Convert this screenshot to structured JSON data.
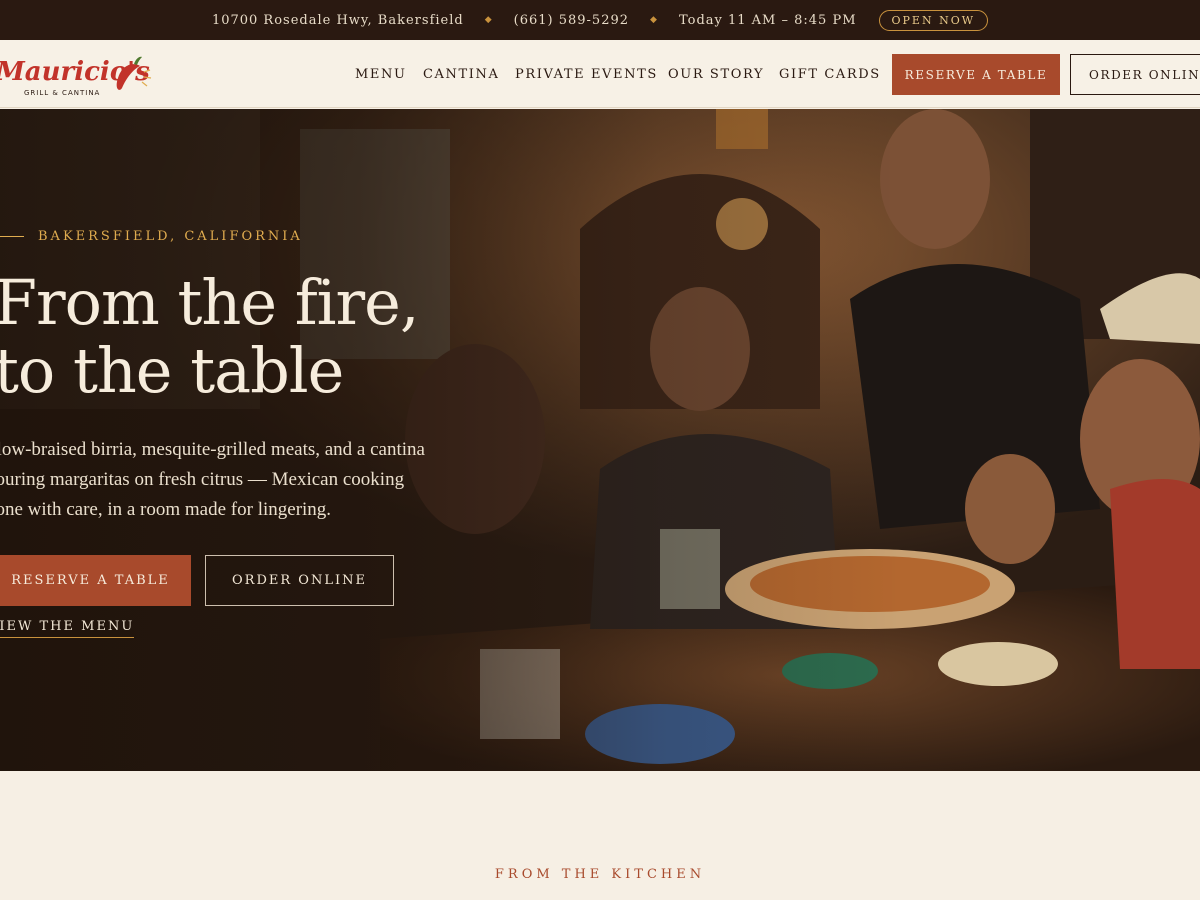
{
  "topbar": {
    "address": "10700 Rosedale Hwy, Bakersfield",
    "phone": "(661) 589-5292",
    "hours": "Today 11 AM – 8:45 PM",
    "status": "OPEN NOW",
    "colors": {
      "background": "#2a1911",
      "accent": "#c9923d"
    }
  },
  "brand": {
    "name": "Mauricio's",
    "tagline": "GRILL & CANTINA",
    "logo_color": "#c2332a"
  },
  "nav": {
    "items": [
      {
        "label": "MENU"
      },
      {
        "label": "CANTINA"
      },
      {
        "label": "PRIVATE EVENTS"
      },
      {
        "label": "OUR STORY"
      },
      {
        "label": "GIFT CARDS"
      }
    ],
    "reserve_label": "RESERVE A TABLE",
    "order_label": "ORDER ONLINE"
  },
  "hero": {
    "eyebrow": "BAKERSFIELD, CALIFORNIA",
    "headline_line1": "From the fire,",
    "headline_line2": "to the table",
    "lede": "Slow-braised birria, mesquite-grilled meats, and a cantina pouring margaritas on fresh citrus — Mexican cooking done with care, in a room made for lingering.",
    "reserve_label": "RESERVE A TABLE",
    "order_label": "ORDER ONLINE",
    "menu_link": "VIEW THE MENU",
    "image_icon": "family-dinner-photo",
    "colors": {
      "accent": "#a84a2c",
      "eyebrow": "#e0ac4f"
    }
  },
  "section": {
    "eyebrow": "FROM THE KITCHEN"
  }
}
